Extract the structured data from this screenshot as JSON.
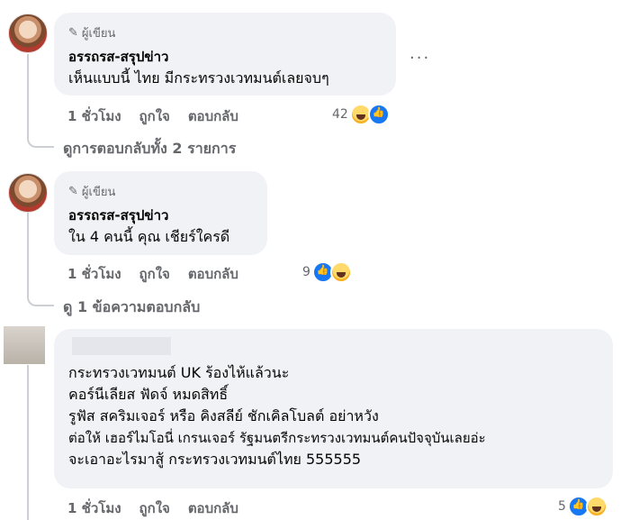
{
  "comments": [
    {
      "author_badge": "ผู้เขียน",
      "name": "อรรถรส-สรุปข่าว",
      "lines": [
        "เห็นแบบนี้ ไทย มีกระทรวงเวทมนต์เลยจบๆ"
      ],
      "time": "1 ชั่วโมง",
      "like_label": "ถูกใจ",
      "reply_label": "ตอบกลับ",
      "reaction_count": "42",
      "view_replies": "ดูการตอบกลับทั้ง 2 รายการ"
    },
    {
      "author_badge": "ผู้เขียน",
      "name": "อรรถรส-สรุปข่าว",
      "lines": [
        "ใน 4 คนนี้ คุณ เชียร์ใครดี"
      ],
      "time": "1 ชั่วโมง",
      "like_label": "ถูกใจ",
      "reply_label": "ตอบกลับ",
      "reaction_count": "9",
      "view_replies": "ดู 1 ข้อความตอบกลับ"
    },
    {
      "lines": [
        "กระทรวงเวทมนต์ UK ร้องไห้แล้วนะ",
        "คอร์นีเลียส ฟัดจ์ หมดสิทธิ์",
        "รูฟัส สคริมเจอร์ หรือ คิงสลีย์ ชักเคิลโบลต์ อย่าหวัง",
        "ต่อให้ เฮอร์ไมโอนี่ เกรนเจอร์ รัฐมนตรีกระทรวงเวทมนต์คนปัจจุบันเลยอ่ะ",
        "จะเอาอะไรมาสู้ กระทรวงเวทมนต์ไทย 555555"
      ],
      "time": "1 ชั่วโมง",
      "like_label": "ถูกใจ",
      "reply_label": "ตอบกลับ",
      "reaction_count": "5"
    }
  ],
  "more_label": "···"
}
